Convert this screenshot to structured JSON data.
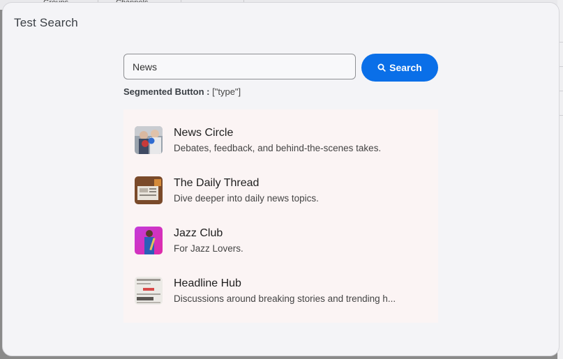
{
  "background": {
    "tabs": [
      "Groups",
      "Channels"
    ]
  },
  "modal": {
    "title": "Test Search"
  },
  "search": {
    "value": "News",
    "button_label": "Search"
  },
  "segmented": {
    "key": "Segmented Button :",
    "value": "[\"type\"]"
  },
  "results": [
    {
      "title": "News Circle",
      "description": "Debates, feedback, and behind-the-scenes takes."
    },
    {
      "title": "The Daily Thread",
      "description": "Dive deeper into daily news topics."
    },
    {
      "title": "Jazz Club",
      "description": "For Jazz Lovers."
    },
    {
      "title": "Headline Hub",
      "description": "Discussions around breaking stories and trending h..."
    }
  ],
  "colors": {
    "accent": "#0a6fe8",
    "results_bg": "#fbf4f4",
    "modal_bg": "#f4f4f7"
  }
}
